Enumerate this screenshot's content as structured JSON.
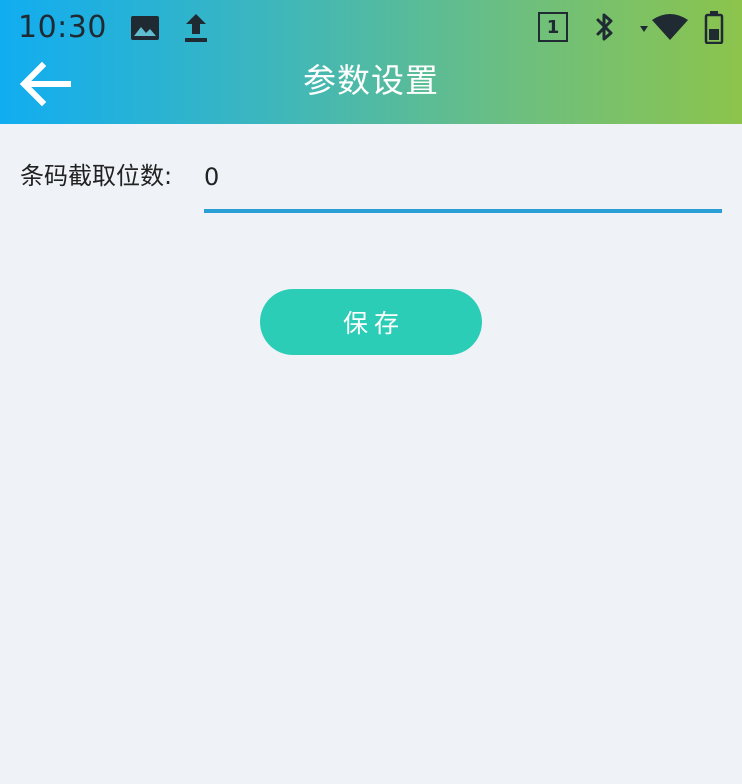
{
  "status_bar": {
    "time": "10:30",
    "sim_badge": "1",
    "icons": [
      "image-icon",
      "upload-icon",
      "sim-card-icon",
      "bluetooth-icon",
      "wifi-icon",
      "battery-icon"
    ]
  },
  "toolbar": {
    "title": "参数设置",
    "back_icon": "arrow-left-icon"
  },
  "form": {
    "barcode_digits_label": "条码截取位数:",
    "barcode_digits_value": "0"
  },
  "actions": {
    "save_label": "保存"
  },
  "colors": {
    "header_gradient_start": "#11adf1",
    "header_gradient_end": "#8cc44c",
    "page_background": "#eff3f7",
    "underline": "#2a9fd6",
    "save_button": "#2ccdb6"
  }
}
